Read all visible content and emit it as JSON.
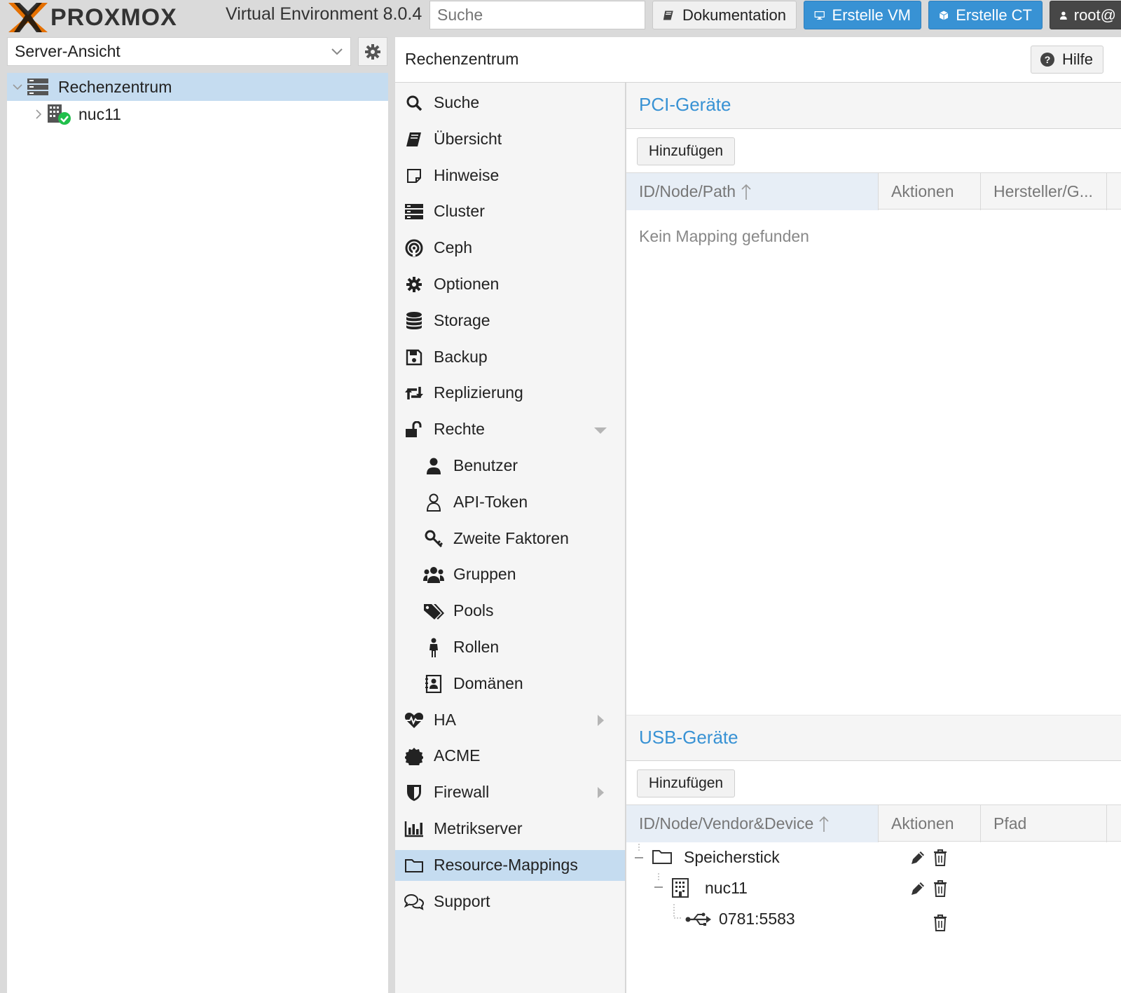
{
  "header": {
    "logo_text": "PROXMOX",
    "version": "Virtual Environment 8.0.4",
    "search_placeholder": "Suche",
    "doc_button": "Dokumentation",
    "create_vm_button": "Erstelle VM",
    "create_ct_button": "Erstelle CT",
    "user_button": "root@"
  },
  "sidebar": {
    "view_select": "Server-Ansicht",
    "tree": [
      {
        "label": "Rechenzentrum",
        "selected": true,
        "icon": "datacenter-icon"
      },
      {
        "label": "nuc11",
        "selected": false,
        "icon": "node-online-icon"
      }
    ]
  },
  "main": {
    "title": "Rechenzentrum",
    "help_button": "Hilfe"
  },
  "nav": {
    "items": [
      {
        "label": "Suche",
        "icon": "search-icon"
      },
      {
        "label": "Übersicht",
        "icon": "book-icon"
      },
      {
        "label": "Hinweise",
        "icon": "sticky-note-icon"
      },
      {
        "label": "Cluster",
        "icon": "server-icon"
      },
      {
        "label": "Ceph",
        "icon": "ceph-icon"
      },
      {
        "label": "Optionen",
        "icon": "gear-icon"
      },
      {
        "label": "Storage",
        "icon": "database-icon"
      },
      {
        "label": "Backup",
        "icon": "floppy-icon"
      },
      {
        "label": "Replizierung",
        "icon": "retweet-icon"
      },
      {
        "label": "Rechte",
        "icon": "unlock-icon",
        "expanded": true
      },
      {
        "label": "Benutzer",
        "icon": "user-icon",
        "child": true
      },
      {
        "label": "API-Token",
        "icon": "user-outline-icon",
        "child": true
      },
      {
        "label": "Zweite Faktoren",
        "icon": "key-icon",
        "child": true
      },
      {
        "label": "Gruppen",
        "icon": "users-icon",
        "child": true
      },
      {
        "label": "Pools",
        "icon": "tags-icon",
        "child": true
      },
      {
        "label": "Rollen",
        "icon": "male-icon",
        "child": true
      },
      {
        "label": "Domänen",
        "icon": "address-book-icon",
        "child": true
      },
      {
        "label": "HA",
        "icon": "heartbeat-icon",
        "collapsed": true
      },
      {
        "label": "ACME",
        "icon": "certificate-icon"
      },
      {
        "label": "Firewall",
        "icon": "shield-icon",
        "collapsed": true
      },
      {
        "label": "Metrikserver",
        "icon": "bar-chart-icon"
      },
      {
        "label": "Resource-Mappings",
        "icon": "folder-icon",
        "selected": true
      },
      {
        "label": "Support",
        "icon": "comments-icon"
      }
    ]
  },
  "pci": {
    "title": "PCI-Geräte",
    "add_button": "Hinzufügen",
    "columns": [
      "ID/Node/Path",
      "Aktionen",
      "Hersteller/G..."
    ],
    "empty_text": "Kein Mapping gefunden"
  },
  "usb": {
    "title": "USB-Geräte",
    "add_button": "Hinzufügen",
    "columns": [
      "ID/Node/Vendor&Device",
      "Aktionen",
      "Pfad"
    ],
    "rows": [
      {
        "label": "Speicherstick",
        "icon": "folder-icon",
        "level": 0,
        "edit": true
      },
      {
        "label": "nuc11",
        "icon": "building-icon",
        "level": 1,
        "edit": true
      },
      {
        "label": "0781:5583",
        "icon": "usb-icon",
        "level": 2,
        "edit": false
      }
    ]
  },
  "colors": {
    "accent": "#3892d4",
    "selection": "#c5dcf0",
    "brand_orange": "#e57000"
  }
}
